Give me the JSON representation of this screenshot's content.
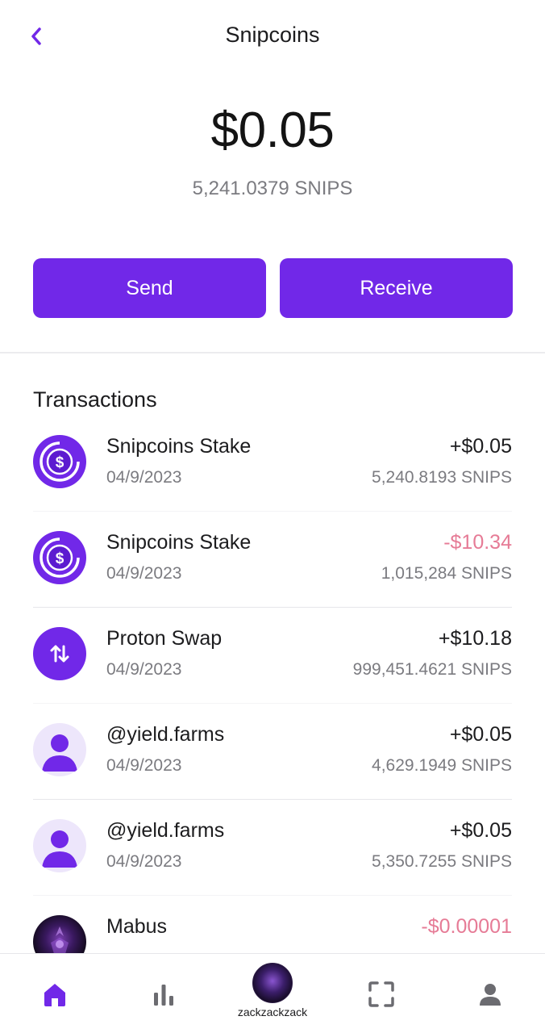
{
  "header": {
    "title": "Snipcoins"
  },
  "balance": {
    "usd": "$0.05",
    "tokens": "5,241.0379 SNIPS"
  },
  "actions": {
    "send_label": "Send",
    "receive_label": "Receive"
  },
  "transactions": {
    "heading": "Transactions",
    "items": [
      {
        "name": "Snipcoins Stake",
        "date": "04/9/2023",
        "amount": "+$0.05",
        "tokens": "5,240.8193 SNIPS",
        "icon": "snipcoin-icon"
      },
      {
        "name": "Snipcoins Stake",
        "date": "04/9/2023",
        "amount": "-$10.34",
        "tokens": "1,015,284 SNIPS",
        "icon": "snipcoin-icon"
      },
      {
        "name": "Proton Swap",
        "date": "04/9/2023",
        "amount": "+$10.18",
        "tokens": "999,451.4621 SNIPS",
        "icon": "swap-icon"
      },
      {
        "name": "@yield.farms",
        "date": "04/9/2023",
        "amount": "+$0.05",
        "tokens": "4,629.1949 SNIPS",
        "icon": "user-avatar-icon"
      },
      {
        "name": "@yield.farms",
        "date": "04/9/2023",
        "amount": "+$0.05",
        "tokens": "5,350.7255 SNIPS",
        "icon": "user-avatar-icon"
      },
      {
        "name": "Mabus",
        "date": "",
        "amount": "-$0.00001",
        "tokens": "",
        "icon": "profile-image"
      }
    ]
  },
  "tabbar": {
    "items": [
      {
        "icon": "home-icon"
      },
      {
        "icon": "bar-chart-icon"
      },
      {
        "icon": "profile-image",
        "label": "zackzackzack"
      },
      {
        "icon": "scan-icon"
      },
      {
        "icon": "person-icon"
      }
    ]
  },
  "colors": {
    "accent": "#7128e8",
    "negative": "#e67b96",
    "muted": "#7b7b80",
    "icon_gray": "#6b6b70"
  }
}
